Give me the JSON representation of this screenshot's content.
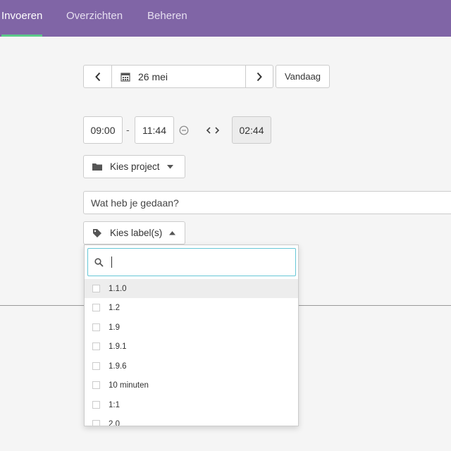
{
  "nav": {
    "items": [
      {
        "label": "Invoeren",
        "active": true
      },
      {
        "label": "Overzichten",
        "active": false
      },
      {
        "label": "Beheren",
        "active": false
      }
    ]
  },
  "datebar": {
    "prev_icon": "chevron-left-icon",
    "calendar_icon": "calendar-icon",
    "date": "26 mei",
    "next_icon": "chevron-right-icon",
    "today_label": "Vandaag"
  },
  "time": {
    "start": "09:00",
    "separator": "-",
    "end": "11:44",
    "duration": "02:44"
  },
  "project": {
    "icon": "folder-icon",
    "label": "Kies project"
  },
  "description": {
    "placeholder": "Wat heb je gedaan?"
  },
  "labels": {
    "icon": "tag-icon",
    "label": "Kies label(s)",
    "search_value": "",
    "options": [
      "1.1.0",
      "1.2",
      "1.9",
      "1.9.1",
      "1.9.6",
      "10 minuten",
      "1:1",
      "2.0"
    ]
  },
  "colors": {
    "nav_bg": "#8065a6",
    "nav_active_underline": "#5cc98a",
    "search_focus": "#66c7d6"
  }
}
